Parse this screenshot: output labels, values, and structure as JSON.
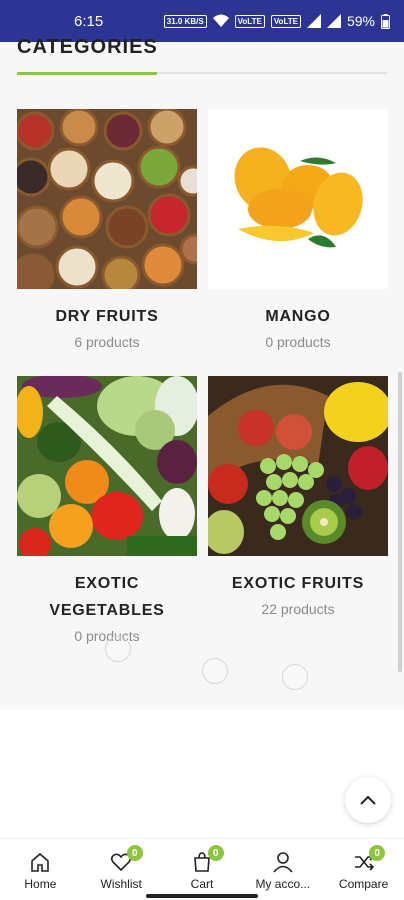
{
  "status_bar": {
    "time": "6:15",
    "speed_label": "31.0 KB/S",
    "volte_1": "VoLTE",
    "volte_2": "VoLTE",
    "battery": "59%"
  },
  "section": {
    "title": "CATEGORIES"
  },
  "categories": [
    {
      "name": "DRY FRUITS",
      "count": "6 products"
    },
    {
      "name": "MANGO",
      "count": "0 products"
    },
    {
      "name_line1": "EXOTIC",
      "name_line2": "VEGETABLES",
      "count": "0 products"
    },
    {
      "name": "EXOTIC FRUITS",
      "count": "22 products"
    }
  ],
  "bottom_nav": {
    "home": "Home",
    "wishlist": "Wishlist",
    "wishlist_badge": "0",
    "cart": "Cart",
    "cart_badge": "0",
    "account": "My acco...",
    "compare": "Compare",
    "compare_badge": "0"
  },
  "colors": {
    "accent": "#8cc63f",
    "status_bar": "#2c3593"
  }
}
